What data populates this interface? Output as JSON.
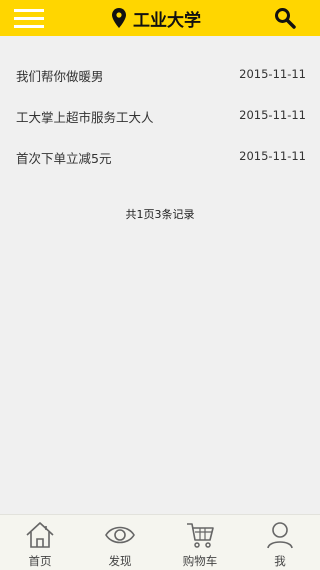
{
  "header": {
    "menu_icon": "menu-icon",
    "location_icon": "location-pin-icon",
    "title": "工业大学",
    "search_icon": "search-icon",
    "background": "#ffd600"
  },
  "news": [
    {
      "title": "我们帮你做暖男",
      "date": "2015-11-11"
    },
    {
      "title": "工大掌上超市服务工大人",
      "date": "2015-11-11"
    },
    {
      "title": "首次下单立减5元",
      "date": "2015-11-11"
    }
  ],
  "pagination": "共1页3条记录",
  "tabs": [
    {
      "label": "首页",
      "icon": "home-icon"
    },
    {
      "label": "发现",
      "icon": "eye-icon"
    },
    {
      "label": "购物车",
      "icon": "cart-icon"
    },
    {
      "label": "我",
      "icon": "user-icon"
    }
  ]
}
